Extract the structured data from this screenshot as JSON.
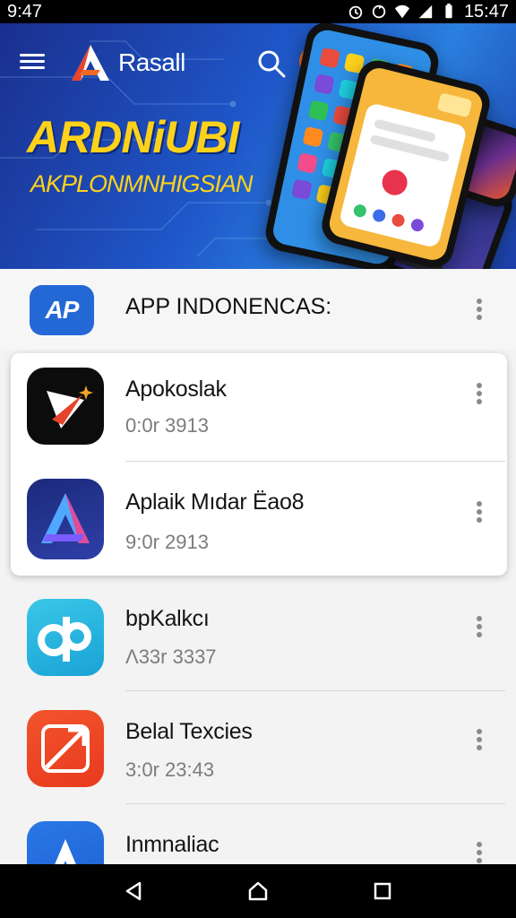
{
  "status_bar": {
    "time_left": "9:47",
    "time_right": "15:47"
  },
  "hero": {
    "brand_name": "Rasall",
    "title": "ARDNiUBI",
    "subtitle": "AKPLONMNHIGSIAN"
  },
  "list_header": {
    "title": "APP INDONENCAS:",
    "icon_label": "AP"
  },
  "apps": [
    {
      "name": "Apokoslak",
      "meta": "0:0r 3913"
    },
    {
      "name": "Aplaik Mıdar Ëao8",
      "meta": "9:0r 2913"
    },
    {
      "name": "bpKalkcı",
      "meta": "Λ33r 3337"
    },
    {
      "name": "Belal Texcies",
      "meta": "3:0r 23:43"
    },
    {
      "name": "Inmnaliac",
      "meta": ""
    }
  ],
  "icons": {
    "menu": "hamburger-icon",
    "search": "search-icon",
    "avatar": "profile-avatar-icon",
    "more": "more-vertical-icon",
    "back": "back-triangle-icon",
    "home": "home-icon",
    "recents": "recents-square-icon"
  },
  "colors": {
    "hero_blue": "#1f56c8",
    "accent_yellow": "#ffd21a",
    "avatar_orange": "#f06a24"
  }
}
